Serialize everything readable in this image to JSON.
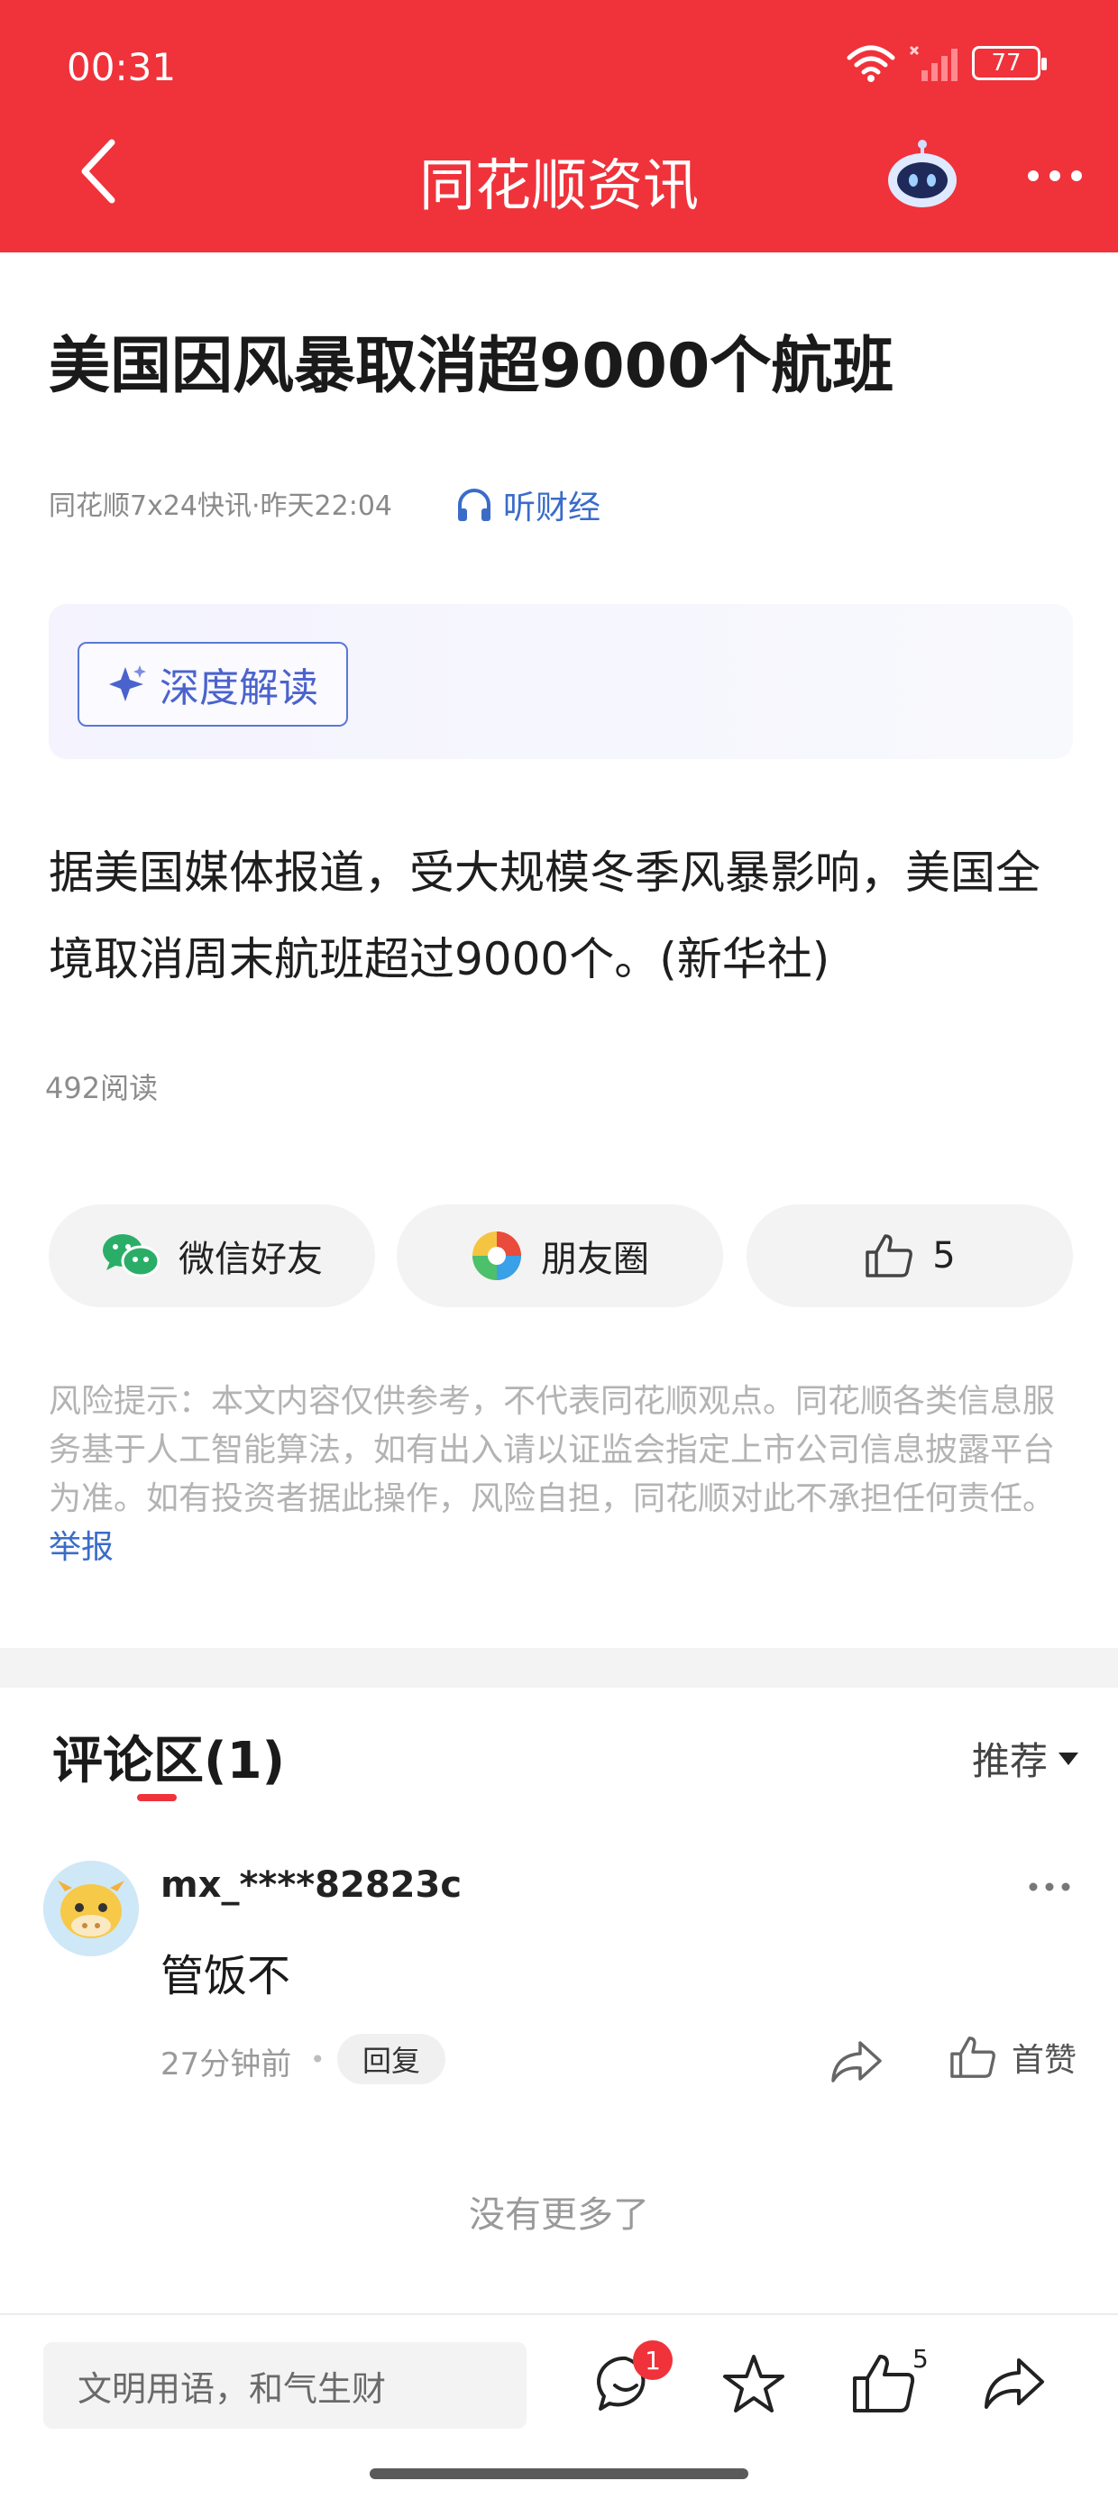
{
  "status_bar": {
    "time": "00:31",
    "battery": "77"
  },
  "nav": {
    "title": "同花顺资讯"
  },
  "article": {
    "headline": "美国因风暴取消超9000个航班",
    "meta": "同花顺7x24快讯·昨天22:04",
    "listen_label": "听财经",
    "deep_read_label": "深度解读",
    "body": "据美国媒体报道，受大规模冬季风暴影响，美国全境取消周末航班超过9000个。(新华社)",
    "read_count": "492阅读"
  },
  "share": {
    "wechat_label": "微信好友",
    "moments_label": "朋友圈",
    "like_count": "5"
  },
  "risk": {
    "text": "风险提示：本文内容仅供参考，不代表同花顺观点。同花顺各类信息服务基于人工智能算法，如有出入请以证监会指定上市公司信息披露平台为准。如有投资者据此操作，风险自担，同花顺对此不承担任何责任。",
    "report_label": "举报"
  },
  "comments": {
    "title": "评论区(1)",
    "sort_label": "推荐",
    "items": [
      {
        "username": "mx_****82823c",
        "text": "管饭不",
        "time": "27分钟前",
        "reply_label": "回复",
        "like_label": "首赞"
      }
    ],
    "no_more": "没有更多了"
  },
  "bottom_bar": {
    "input_placeholder": "文明用语，和气生财",
    "comment_badge": "1",
    "like_count": "5"
  },
  "colors": {
    "brand_red": "#f0323b",
    "link_blue": "#3a6cc8",
    "deep_read_blue": "#4a63cc"
  }
}
